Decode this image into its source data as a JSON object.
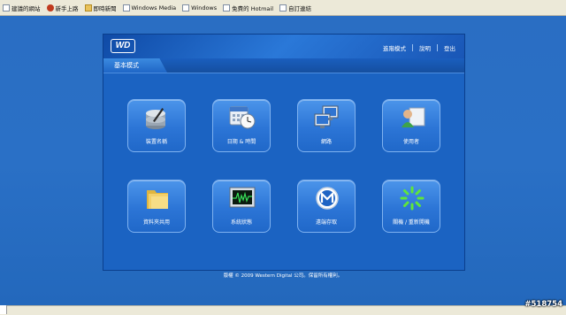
{
  "favorites_bar": {
    "items": [
      {
        "label": "建議的網站",
        "icon": "page-icon"
      },
      {
        "label": "新手上路",
        "icon": "red-circle-icon"
      },
      {
        "label": "即時新聞",
        "icon": "folder-icon"
      },
      {
        "label": "Windows Media",
        "icon": "page-icon"
      },
      {
        "label": "Windows",
        "icon": "page-icon"
      },
      {
        "label": "免費的 Hotmail",
        "icon": "page-icon"
      },
      {
        "label": "自訂連結",
        "icon": "page-icon"
      }
    ]
  },
  "header": {
    "logo_text": "WD",
    "nav": {
      "advanced_mode": "進階模式",
      "help": "說明",
      "logout": "登出"
    }
  },
  "tab": {
    "label": "基本模式"
  },
  "tiles": [
    {
      "label": "裝置名稱",
      "icon": "device-name-icon"
    },
    {
      "label": "日期 & 時間",
      "icon": "date-time-icon"
    },
    {
      "label": "網路",
      "icon": "network-icon"
    },
    {
      "label": "使用者",
      "icon": "users-icon"
    },
    {
      "label": "資料夾共用",
      "icon": "folder-share-icon"
    },
    {
      "label": "系統狀態",
      "icon": "system-status-icon"
    },
    {
      "label": "遠端存取",
      "icon": "remote-access-icon"
    },
    {
      "label": "關機 / 重新開機",
      "icon": "shutdown-restart-icon"
    }
  ],
  "footer": {
    "text": "版權 © 2009 Western Digital 公司。保留所有權利。"
  },
  "watermark": "#518754",
  "colors": {
    "desktop": "#2a6fc4",
    "panel": "#1b63c2",
    "tile": "#2c75d6"
  }
}
